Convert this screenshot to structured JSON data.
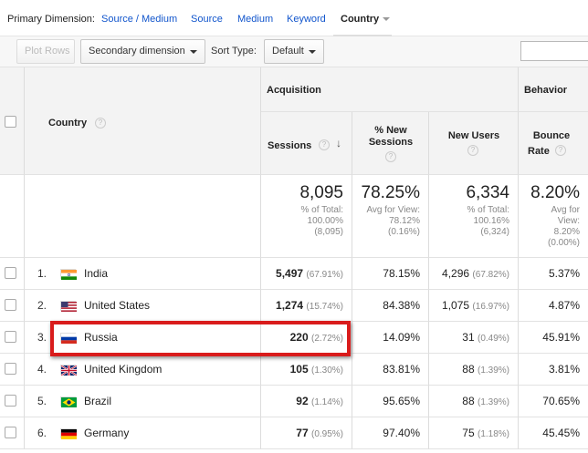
{
  "primary_dimension": {
    "label": "Primary Dimension:",
    "links": [
      "Source / Medium",
      "Source",
      "Medium",
      "Keyword"
    ],
    "active": "Country"
  },
  "toolbar": {
    "plot_rows": "Plot Rows",
    "secondary_dimension": "Secondary dimension",
    "sort_type_label": "Sort Type:",
    "sort_type_value": "Default"
  },
  "table": {
    "country_header": "Country",
    "acquisition_header": "Acquisition",
    "behavior_header": "Behavior",
    "col_sessions": "Sessions",
    "col_new_sessions_line1": "% New",
    "col_new_sessions_line2": "Sessions",
    "col_new_users": "New Users",
    "col_bounce_line1": "Bounce",
    "col_bounce_line2": "Rate",
    "help": "?",
    "sort_arrow": "↓",
    "totals": {
      "sessions": "8,095",
      "sessions_sub": [
        "% of Total:",
        "100.00%",
        "(8,095)"
      ],
      "new_sessions": "78.25%",
      "new_sessions_sub": [
        "Avg for View:",
        "78.12%",
        "(0.16%)"
      ],
      "new_users": "6,334",
      "new_users_sub": [
        "% of Total:",
        "100.16%",
        "(6,324)"
      ],
      "bounce": "8.20%",
      "bounce_sub": [
        "Avg for",
        "View:",
        "8.20%",
        "(0.00%)"
      ]
    },
    "rows": [
      {
        "idx": "1.",
        "country": "India",
        "flag": "india-flag-icon",
        "sessions": "5,497",
        "sessions_pct": "(67.91%)",
        "new_sessions": "78.15%",
        "new_users": "4,296",
        "new_users_pct": "(67.82%)",
        "bounce": "5.37%"
      },
      {
        "idx": "2.",
        "country": "United States",
        "flag": "united-states-flag-icon",
        "sessions": "1,274",
        "sessions_pct": "(15.74%)",
        "new_sessions": "84.38%",
        "new_users": "1,075",
        "new_users_pct": "(16.97%)",
        "bounce": "4.87%"
      },
      {
        "idx": "3.",
        "country": "Russia",
        "flag": "russia-flag-icon",
        "sessions": "220",
        "sessions_pct": "(2.72%)",
        "new_sessions": "14.09%",
        "new_users": "31",
        "new_users_pct": "(0.49%)",
        "bounce": "45.91%"
      },
      {
        "idx": "4.",
        "country": "United Kingdom",
        "flag": "united-kingdom-flag-icon",
        "sessions": "105",
        "sessions_pct": "(1.30%)",
        "new_sessions": "83.81%",
        "new_users": "88",
        "new_users_pct": "(1.39%)",
        "bounce": "3.81%"
      },
      {
        "idx": "5.",
        "country": "Brazil",
        "flag": "brazil-flag-icon",
        "sessions": "92",
        "sessions_pct": "(1.14%)",
        "new_sessions": "95.65%",
        "new_users": "88",
        "new_users_pct": "(1.39%)",
        "bounce": "70.65%"
      },
      {
        "idx": "6.",
        "country": "Germany",
        "flag": "germany-flag-icon",
        "sessions": "77",
        "sessions_pct": "(0.95%)",
        "new_sessions": "97.40%",
        "new_users": "75",
        "new_users_pct": "(1.18%)",
        "bounce": "45.45%"
      }
    ]
  },
  "colors": {
    "link": "#1155cc",
    "highlight": "#d91c1c"
  }
}
